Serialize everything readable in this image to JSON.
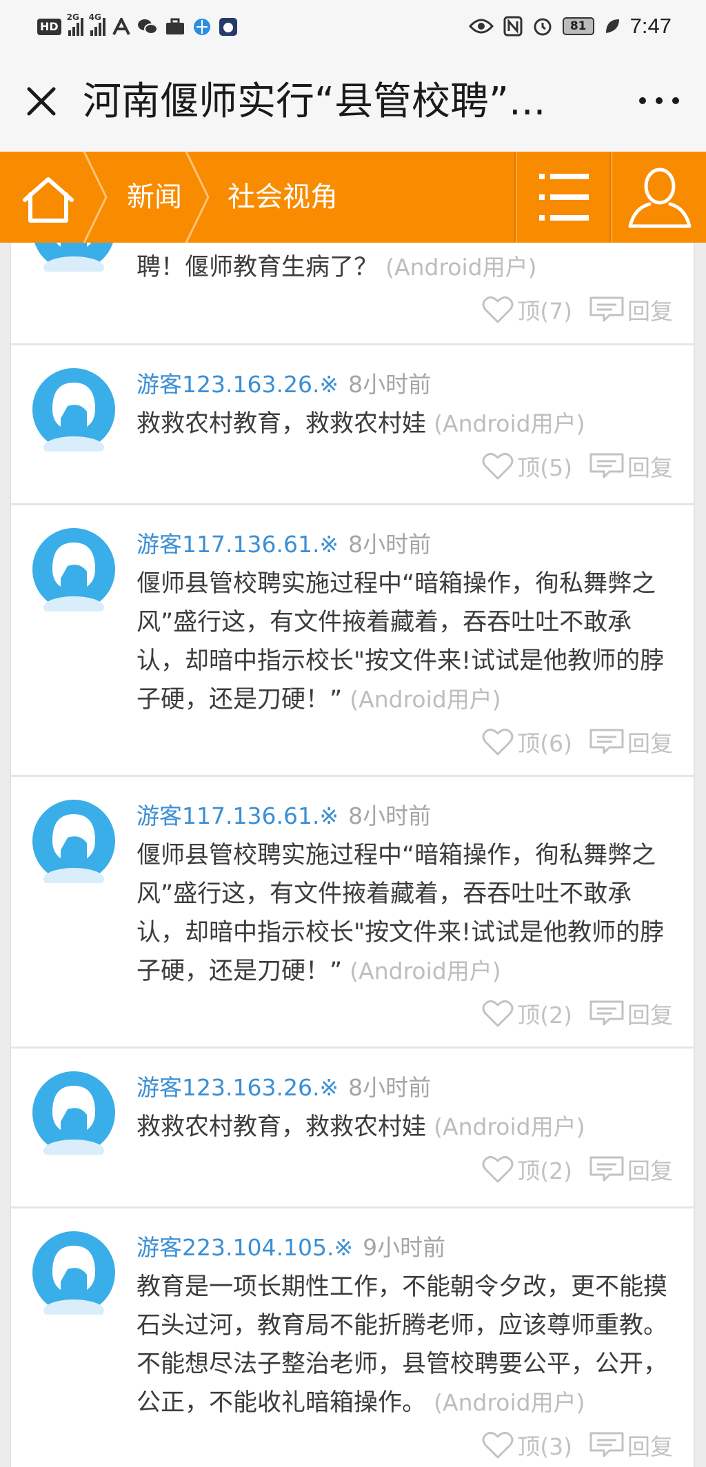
{
  "status_bar": {
    "left_badge": "HD",
    "sim1_label": "2G",
    "sim2_label": "4G",
    "battery": "81",
    "time": "7:47",
    "icons": [
      "hd-icon",
      "signal-icon",
      "signal-icon",
      "a-icon",
      "wechat-icon",
      "briefcase-icon",
      "browser-icon",
      "app-icon",
      "eye-icon",
      "nfc-icon",
      "alarm-icon",
      "battery-icon",
      "leaf-icon"
    ]
  },
  "title_bar": {
    "title": "河南偃师实行“县管校聘”...",
    "close_icon": "close-icon",
    "more_icon": "more-icon"
  },
  "nav": {
    "color": "#f88b00",
    "crumbs": [
      "新闻",
      "社会视角"
    ],
    "icons": [
      "home-icon",
      "menu-icon",
      "user-icon"
    ]
  },
  "comments": [
    {
      "author": "",
      "time": "",
      "body": "聘！偃师教育生病了？",
      "device": "(Android用户)",
      "likes": "顶(7)",
      "reply": "回复"
    },
    {
      "author": "游客123.163.26.※",
      "time": "8小时前",
      "body": "救救农村教育，救救农村娃",
      "device": "(Android用户)",
      "likes": "顶(5)",
      "reply": "回复"
    },
    {
      "author": "游客117.136.61.※",
      "time": "8小时前",
      "body": "偃师县管校聘实施过程中“暗箱操作，徇私舞弊之风”盛行这，有文件掖着藏着，吞吞吐吐不敢承认，却暗中指示校长\"按文件来!试试是他教师的脖子硬，还是刀硬！”",
      "device": "(Android用户)",
      "likes": "顶(6)",
      "reply": "回复"
    },
    {
      "author": "游客117.136.61.※",
      "time": "8小时前",
      "body": "偃师县管校聘实施过程中“暗箱操作，徇私舞弊之风”盛行这，有文件掖着藏着，吞吞吐吐不敢承认，却暗中指示校长\"按文件来!试试是他教师的脖子硬，还是刀硬！”",
      "device": "(Android用户)",
      "likes": "顶(2)",
      "reply": "回复"
    },
    {
      "author": "游客123.163.26.※",
      "time": "8小时前",
      "body": "救救农村教育，救救农村娃",
      "device": "(Android用户)",
      "likes": "顶(2)",
      "reply": "回复"
    },
    {
      "author": "游客223.104.105.※",
      "time": "9小时前",
      "body": "教育是一项长期性工作，不能朝令夕改，更不能摸石头过河，教育局不能折腾老师，应该尊师重教。不能想尽法子整治老师，县管校聘要公平，公开，公正，不能收礼暗箱操作。",
      "device": "(Android用户)",
      "likes": "顶(3)",
      "reply": "回复"
    }
  ]
}
